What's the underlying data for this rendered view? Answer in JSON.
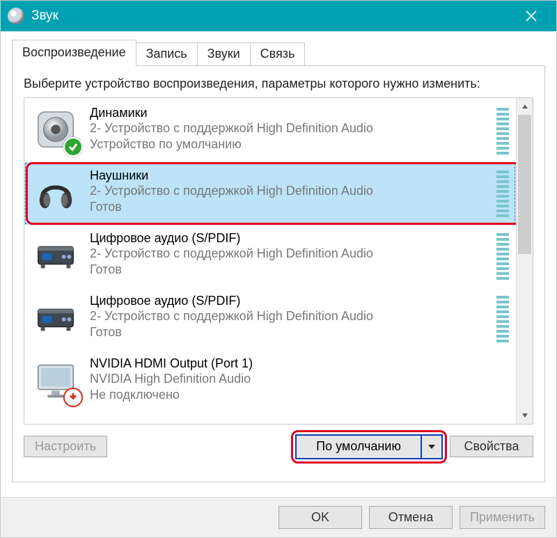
{
  "window": {
    "title": "Звук",
    "close_label": "Закрыть"
  },
  "tabs": {
    "playback": "Воспроизведение",
    "recording": "Запись",
    "sounds": "Звуки",
    "communications": "Связь"
  },
  "instruction": "Выберите устройство воспроизведения, параметры которого нужно изменить:",
  "devices": [
    {
      "title": "Динамики",
      "subtitle": "2- Устройство с поддержкой High Definition Audio",
      "status": "Устройство по умолчанию",
      "icon": "speaker",
      "badge": "check",
      "selected": false
    },
    {
      "title": "Наушники",
      "subtitle": "2- Устройство с поддержкой High Definition Audio",
      "status": "Готов",
      "icon": "headphones",
      "badge": null,
      "selected": true,
      "highlighted": true
    },
    {
      "title": "Цифровое аудио (S/PDIF)",
      "subtitle": "2- Устройство с поддержкой High Definition Audio",
      "status": "Готов",
      "icon": "spdif",
      "badge": null,
      "selected": false
    },
    {
      "title": "Цифровое аудио (S/PDIF)",
      "subtitle": "2- Устройство с поддержкой High Definition Audio",
      "status": "Готов",
      "icon": "spdif",
      "badge": null,
      "selected": false
    },
    {
      "title": "NVIDIA HDMI Output (Port 1)",
      "subtitle": "NVIDIA High Definition Audio",
      "status": "Не подключено",
      "icon": "monitor",
      "badge": "down",
      "selected": false
    }
  ],
  "panel_buttons": {
    "configure": "Настроить",
    "set_default": "По умолчанию",
    "properties": "Свойства"
  },
  "footer_buttons": {
    "ok": "OK",
    "cancel": "Отмена",
    "apply": "Применить"
  }
}
